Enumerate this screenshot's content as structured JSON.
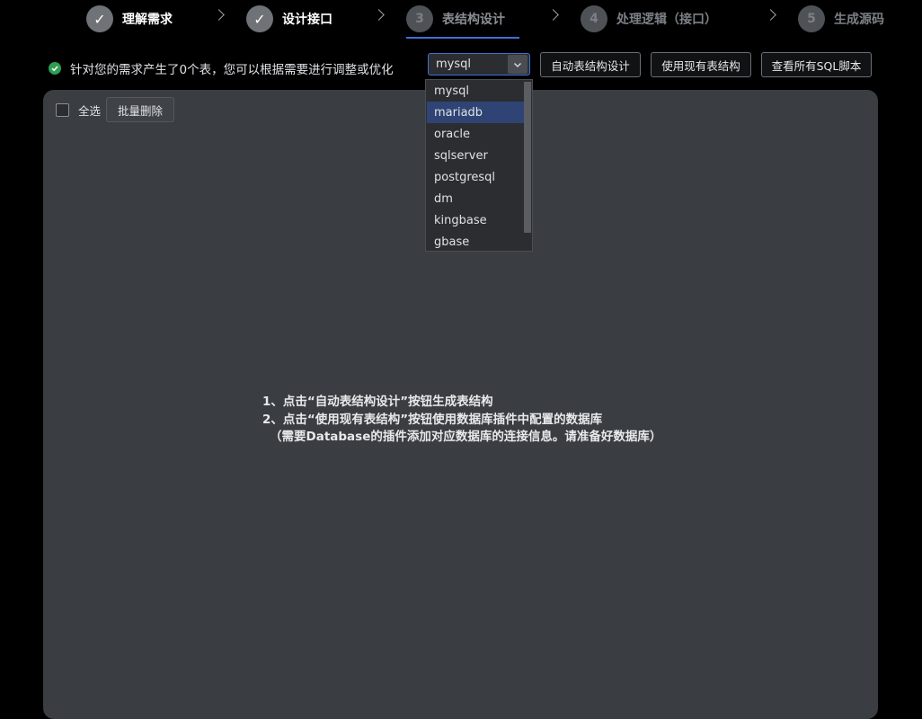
{
  "stepper": {
    "steps": [
      {
        "num": "✓",
        "label": "理解需求",
        "state": "done"
      },
      {
        "num": "✓",
        "label": "设计接口",
        "state": "done"
      },
      {
        "num": "3",
        "label": "表结构设计",
        "state": "active"
      },
      {
        "num": "4",
        "label": "处理逻辑（接口）",
        "state": "todo"
      },
      {
        "num": "5",
        "label": "生成源码",
        "state": "todo"
      }
    ]
  },
  "info": {
    "text": "针对您的需求产生了0个表，您可以根据需要进行调整或优化",
    "icon": "check-circle-icon",
    "icon_color": "#2e9e51"
  },
  "db_select": {
    "value": "mysql",
    "options": [
      "mysql",
      "mariadb",
      "oracle",
      "sqlserver",
      "postgresql",
      "dm",
      "kingbase",
      "gbase"
    ],
    "highlighted": "mariadb"
  },
  "toolbar": {
    "auto_design": "自动表结构设计",
    "use_existing": "使用现有表结构",
    "view_sql": "查看所有SQL脚本"
  },
  "table_controls": {
    "select_all": "全选",
    "batch_delete": "批量删除"
  },
  "hint": {
    "line1": "1、点击“自动表结构设计”按钮生成表结构",
    "line2": "2、点击“使用现有表结构”按钮使用数据库插件中配置的数据库",
    "line3": "（需要Database的插件添加对应数据库的连接信息。请准备好数据库）"
  },
  "colors": {
    "accent": "#3f6fd8",
    "panel": "#3a3d41",
    "highlight": "#2f4474"
  }
}
